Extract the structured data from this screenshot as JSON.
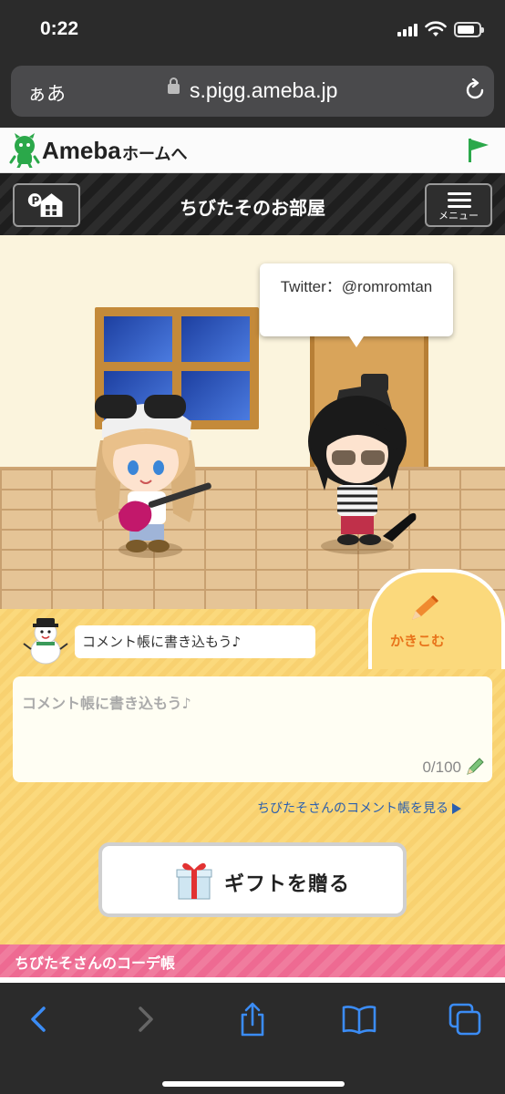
{
  "status_bar": {
    "time": "0:22"
  },
  "browser": {
    "text_size_button": "ぁあ",
    "url": "s.pigg.ameba.jp"
  },
  "ameba_header": {
    "logo": "Ameba",
    "home_link": "ホームへ"
  },
  "title_bar": {
    "title": "ちびたそのお部屋",
    "menu_label": "メニュー"
  },
  "room": {
    "speech_bubble": "Twitter：@romromtan"
  },
  "comment": {
    "write_button": "かきこむ",
    "hint": "コメント帳に書き込もう♪",
    "placeholder": "コメント帳に書き込もう♪",
    "char_count": "0/100",
    "view_link": "ちびたそさんのコメント帳を見る"
  },
  "gift_button": {
    "label": "ギフトを贈る"
  },
  "coordinate_section": {
    "title": "ちびたそさんのコーデ帳"
  },
  "colors": {
    "accent_orange": "#e8731a",
    "link_blue": "#2b5fae",
    "pink_bar": "#ee6a92",
    "comment_bg": "#fbd97c"
  }
}
